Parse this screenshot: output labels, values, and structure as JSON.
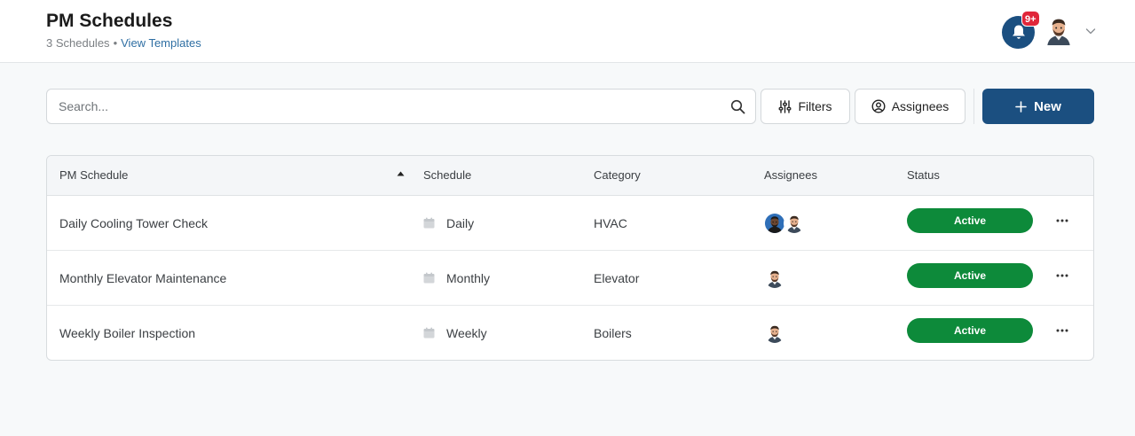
{
  "header": {
    "title": "PM Schedules",
    "count_text": "3 Schedules",
    "separator": "•",
    "view_templates": "View Templates",
    "notification_badge": "9+"
  },
  "toolbar": {
    "search_placeholder": "Search...",
    "filters_label": "Filters",
    "assignees_label": "Assignees",
    "new_label": "New"
  },
  "table": {
    "columns": [
      "PM Schedule",
      "Schedule",
      "Category",
      "Assignees",
      "Status"
    ],
    "sort": "ascending",
    "rows": [
      {
        "name": "Daily Cooling Tower Check",
        "schedule": "Daily",
        "category": "HVAC",
        "assignees": [
          "dark-skinned man avatar",
          "bearded man avatar"
        ],
        "status": "Active"
      },
      {
        "name": "Monthly Elevator Maintenance",
        "schedule": "Monthly",
        "category": "Elevator",
        "assignees": [
          "bearded man avatar"
        ],
        "status": "Active"
      },
      {
        "name": "Weekly Boiler Inspection",
        "schedule": "Weekly",
        "category": "Boilers",
        "assignees": [
          "bearded man avatar"
        ],
        "status": "Active"
      }
    ]
  },
  "colors": {
    "primary": "#1b4f80",
    "status_active": "#0d8a3a",
    "badge": "#e0263a",
    "link": "#2f6fa3"
  },
  "icons": [
    "bell-icon",
    "chevron-down-icon",
    "search-icon",
    "sliders-icon",
    "user-circle-icon",
    "plus-icon",
    "sort-up-icon",
    "calendar-icon",
    "more-horizontal-icon"
  ]
}
